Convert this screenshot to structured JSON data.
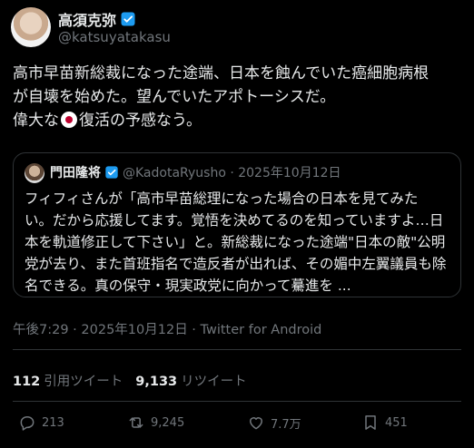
{
  "author": {
    "name": "高須克弥",
    "handle": "@katsuyatakasu"
  },
  "tweet": {
    "line1": "高市早苗新総裁になった途端、日本を蝕んでいた癌細胞病根",
    "line2": "が自壊を始めた。望んでいたアポトーシスだ。",
    "line3_before": "偉大な",
    "line3_after": "復活の予感なう。"
  },
  "quote": {
    "name": "門田隆将",
    "handle_date": "@KadotaRyusho · 2025年10月12日",
    "lines": [
      "フィフィさんが「高市早苗総理になった場合の日本を見てみた",
      "い。だから応援してます。覚悟を決めてるのを知っていますよ…日",
      "本を軌道修正して下さい」と。新総裁になった途端\"日本の敵\"公明",
      "党が去り、また首班指名で造反者が出れば、その媚中左翼議員も除",
      "名できる。真の保守・現実政党に向かって驀進を ..."
    ]
  },
  "timestamp": "午後7:29 · 2025年10月12日 · Twitter for Android",
  "stats": {
    "quotes_count": "112",
    "quotes_label": "引用ツイート",
    "retweets_count": "9,133",
    "retweets_label": "リツイート"
  },
  "actions": {
    "reply_count": "213",
    "retweet_count": "9,245",
    "like_count": "7.7万",
    "bookmark_count": "451"
  },
  "colors": {
    "background": "#000000",
    "text": "#e7e9ea",
    "muted": "#71767b",
    "verified": "#1d9bf0",
    "border": "#2f3336"
  }
}
